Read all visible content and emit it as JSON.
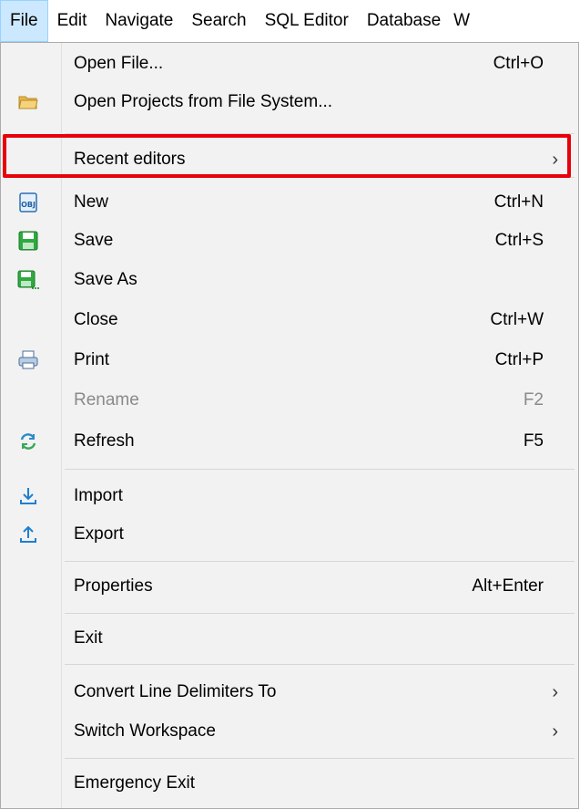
{
  "menubar": {
    "items": [
      "File",
      "Edit",
      "Navigate",
      "Search",
      "SQL Editor",
      "Database",
      "W"
    ]
  },
  "menu": {
    "open_file": {
      "label": "Open File...",
      "shortcut": "Ctrl+O"
    },
    "open_projects": {
      "label": "Open Projects from File System...",
      "icon": "folder-icon"
    },
    "recent_editors": {
      "label": "Recent editors",
      "arrow": "›"
    },
    "new": {
      "label": "New",
      "shortcut": "Ctrl+N",
      "icon": "new-obj-icon"
    },
    "save": {
      "label": "Save",
      "shortcut": "Ctrl+S",
      "icon": "save-icon"
    },
    "save_as": {
      "label": "Save As",
      "icon": "save-as-icon"
    },
    "close": {
      "label": "Close",
      "shortcut": "Ctrl+W"
    },
    "print": {
      "label": "Print",
      "shortcut": "Ctrl+P",
      "icon": "print-icon"
    },
    "rename": {
      "label": "Rename",
      "shortcut": "F2",
      "disabled": true
    },
    "refresh": {
      "label": "Refresh",
      "shortcut": "F5",
      "icon": "refresh-icon"
    },
    "import": {
      "label": "Import",
      "icon": "import-icon"
    },
    "export": {
      "label": "Export",
      "icon": "export-icon"
    },
    "properties": {
      "label": "Properties",
      "shortcut": "Alt+Enter"
    },
    "exit": {
      "label": "Exit"
    },
    "convert_line_delimiters": {
      "label": "Convert Line Delimiters To",
      "arrow": "›"
    },
    "switch_workspace": {
      "label": "Switch Workspace",
      "arrow": "›"
    },
    "emergency_exit": {
      "label": "Emergency Exit"
    }
  },
  "colors": {
    "highlight_border": "#e8000b",
    "menu_background": "#f2f2f2",
    "active_menubar": "#cce8ff"
  }
}
